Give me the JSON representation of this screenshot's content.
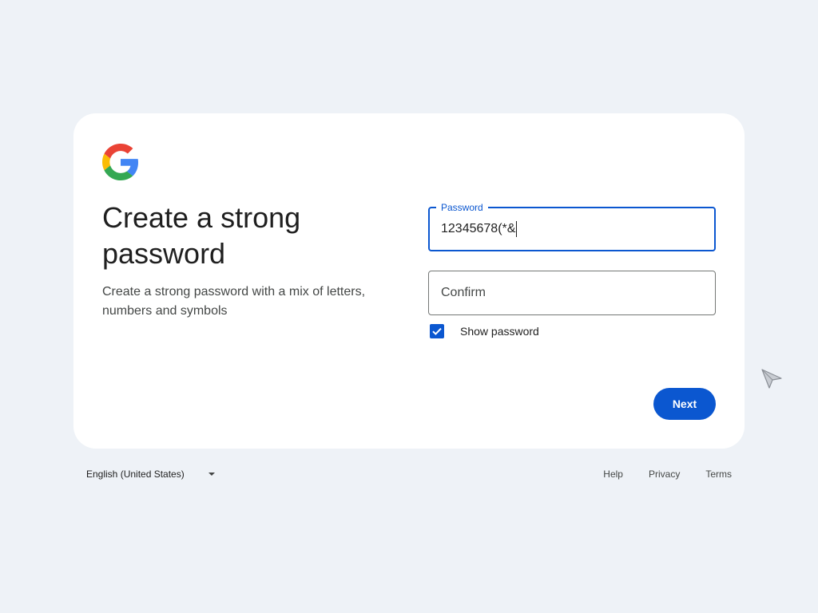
{
  "card": {
    "title": "Create a strong password",
    "subtitle": "Create a strong password with a mix of letters, numbers and symbols",
    "password_field": {
      "label": "Password",
      "value": "12345678(*&"
    },
    "confirm_field": {
      "placeholder": "Confirm",
      "value": ""
    },
    "show_password": {
      "label": "Show password",
      "checked": true
    },
    "next_label": "Next"
  },
  "footer": {
    "language": "English (United States)",
    "links": [
      "Help",
      "Privacy",
      "Terms"
    ]
  },
  "colors": {
    "accent": "#0b57d0",
    "background": "#eef2f7",
    "card": "#ffffff"
  },
  "icons": [
    "google-logo-icon",
    "checkbox-checked-icon",
    "dropdown-caret-icon",
    "mouse-cursor-icon"
  ]
}
